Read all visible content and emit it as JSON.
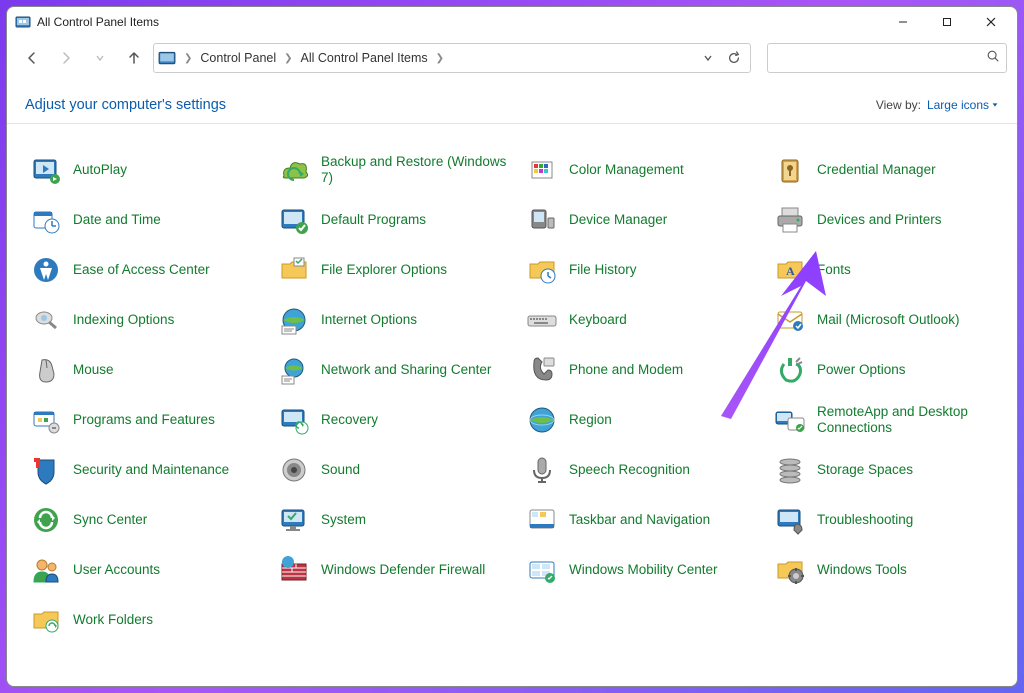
{
  "window": {
    "title": "All Control Panel Items"
  },
  "breadcrumb": {
    "root": "Control Panel",
    "current": "All Control Panel Items"
  },
  "heading": "Adjust your computer's settings",
  "viewby": {
    "label": "View by:",
    "value": "Large icons"
  },
  "search": {
    "placeholder": ""
  },
  "items": [
    {
      "label": "AutoPlay"
    },
    {
      "label": "Backup and Restore (Windows 7)"
    },
    {
      "label": "Color Management"
    },
    {
      "label": "Credential Manager"
    },
    {
      "label": "Date and Time"
    },
    {
      "label": "Default Programs"
    },
    {
      "label": "Device Manager"
    },
    {
      "label": "Devices and Printers"
    },
    {
      "label": "Ease of Access Center"
    },
    {
      "label": "File Explorer Options"
    },
    {
      "label": "File History"
    },
    {
      "label": "Fonts"
    },
    {
      "label": "Indexing Options"
    },
    {
      "label": "Internet Options"
    },
    {
      "label": "Keyboard"
    },
    {
      "label": "Mail (Microsoft Outlook)"
    },
    {
      "label": "Mouse"
    },
    {
      "label": "Network and Sharing Center"
    },
    {
      "label": "Phone and Modem"
    },
    {
      "label": "Power Options"
    },
    {
      "label": "Programs and Features"
    },
    {
      "label": "Recovery"
    },
    {
      "label": "Region"
    },
    {
      "label": "RemoteApp and Desktop Connections"
    },
    {
      "label": "Security and Maintenance"
    },
    {
      "label": "Sound"
    },
    {
      "label": "Speech Recognition"
    },
    {
      "label": "Storage Spaces"
    },
    {
      "label": "Sync Center"
    },
    {
      "label": "System"
    },
    {
      "label": "Taskbar and Navigation"
    },
    {
      "label": "Troubleshooting"
    },
    {
      "label": "User Accounts"
    },
    {
      "label": "Windows Defender Firewall"
    },
    {
      "label": "Windows Mobility Center"
    },
    {
      "label": "Windows Tools"
    },
    {
      "label": "Work Folders"
    }
  ],
  "icons": {
    "AutoPlay": "autoplay",
    "Backup and Restore (Windows 7)": "backup",
    "Color Management": "color",
    "Credential Manager": "credential",
    "Date and Time": "datetime",
    "Default Programs": "default-programs",
    "Device Manager": "device-manager",
    "Devices and Printers": "printers",
    "Ease of Access Center": "ease",
    "File Explorer Options": "folder-options",
    "File History": "file-history",
    "Fonts": "fonts",
    "Indexing Options": "indexing",
    "Internet Options": "internet",
    "Keyboard": "keyboard",
    "Mail (Microsoft Outlook)": "mail",
    "Mouse": "mouse",
    "Network and Sharing Center": "network",
    "Phone and Modem": "phone",
    "Power Options": "power",
    "Programs and Features": "programs",
    "Recovery": "recovery",
    "Region": "region",
    "RemoteApp and Desktop Connections": "remoteapp",
    "Security and Maintenance": "security",
    "Sound": "sound",
    "Speech Recognition": "speech",
    "Storage Spaces": "storage",
    "Sync Center": "sync",
    "System": "system",
    "Taskbar and Navigation": "taskbar",
    "Troubleshooting": "troubleshoot",
    "User Accounts": "users",
    "Windows Defender Firewall": "firewall",
    "Windows Mobility Center": "mobility",
    "Windows Tools": "tools",
    "Work Folders": "work-folders"
  }
}
